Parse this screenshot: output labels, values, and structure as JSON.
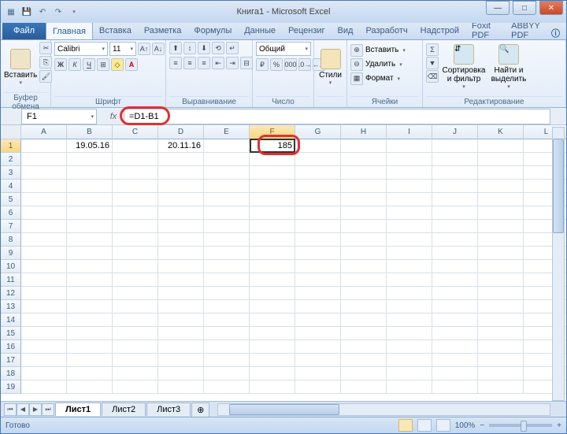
{
  "title": "Книга1 - Microsoft Excel",
  "tabs": {
    "file": "Файл",
    "items": [
      "Главная",
      "Вставка",
      "Разметка",
      "Формулы",
      "Данные",
      "Рецензиг",
      "Вид",
      "Разработч",
      "Надстрой",
      "Foxit PDF",
      "ABBYY PDF"
    ],
    "active": 0
  },
  "ribbon": {
    "clipboard": {
      "paste": "Вставить",
      "label": "Буфер обмена"
    },
    "font": {
      "name": "Calibri",
      "size": "11",
      "label": "Шрифт"
    },
    "align": {
      "label": "Выравнивание"
    },
    "number": {
      "format": "Общий",
      "label": "Число"
    },
    "styles": {
      "btn": "Стили"
    },
    "cells": {
      "insert": "Вставить",
      "delete": "Удалить",
      "format": "Формат",
      "label": "Ячейки"
    },
    "editing": {
      "sort": "Сортировка и фильтр",
      "find": "Найти и выделить",
      "label": "Редактирование"
    }
  },
  "fbar": {
    "name": "F1",
    "formula": "=D1-B1"
  },
  "grid": {
    "cols": [
      "A",
      "B",
      "C",
      "D",
      "E",
      "F",
      "G",
      "H",
      "I",
      "J",
      "K",
      "L"
    ],
    "rows": 19,
    "active_col": 5,
    "active_row": 0,
    "data": {
      "B1": "19.05.16",
      "D1": "20.11.16",
      "F1": "185"
    }
  },
  "sheets": {
    "items": [
      "Лист1",
      "Лист2",
      "Лист3"
    ],
    "active": 0
  },
  "status": {
    "ready": "Готово",
    "zoom": "100%"
  }
}
